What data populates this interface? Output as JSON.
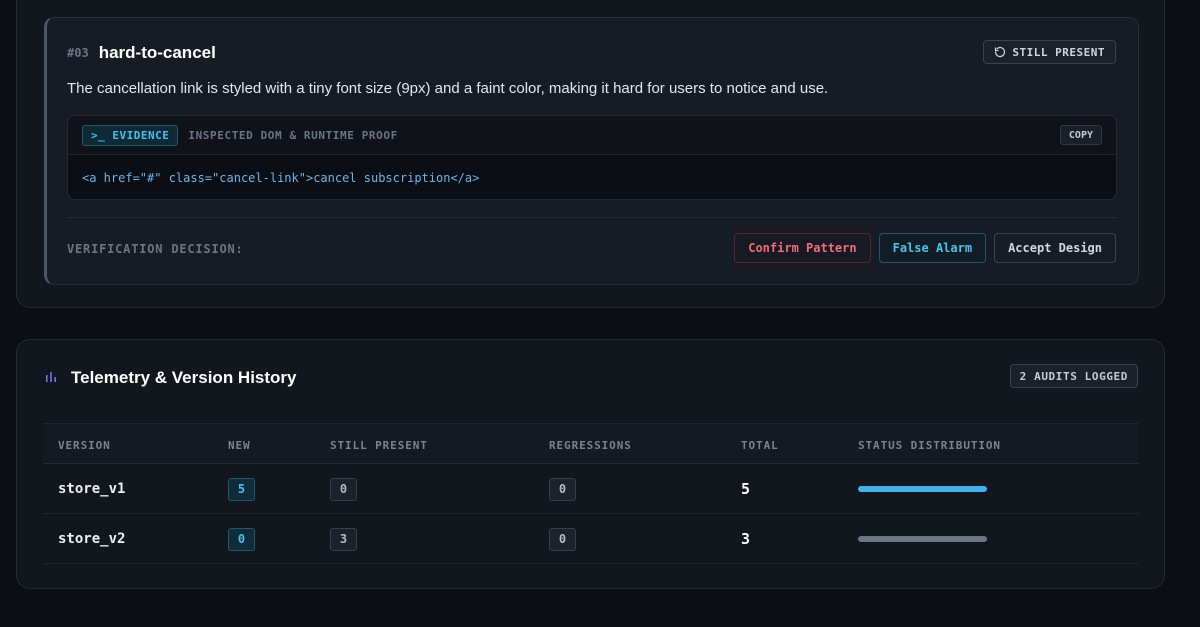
{
  "finding": {
    "number": "#03",
    "title": "hard-to-cancel",
    "status": "STILL PRESENT",
    "status_icon": "rotate-ccw-icon",
    "description": "The cancellation link is styled with a tiny font size (9px) and a faint color, making it hard for users to notice and use.",
    "evidence": {
      "badge": ">_ EVIDENCE",
      "subtitle": "INSPECTED DOM & RUNTIME PROOF",
      "copy_label": "COPY",
      "code": "<a href=\"#\" class=\"cancel-link\">cancel subscription</a>"
    },
    "verification": {
      "label": "VERIFICATION DECISION:",
      "confirm": "Confirm Pattern",
      "false_alarm": "False Alarm",
      "accept": "Accept Design"
    }
  },
  "telemetry": {
    "title": "Telemetry & Version History",
    "icon": "bar-chart-icon",
    "audits_logged": "2 AUDITS LOGGED",
    "columns": [
      "VERSION",
      "NEW",
      "STILL PRESENT",
      "REGRESSIONS",
      "TOTAL",
      "STATUS DISTRIBUTION"
    ],
    "rows": [
      {
        "version": "store_v1",
        "new": "5",
        "still_present": "0",
        "regressions": "0",
        "total": "5",
        "distribution_color": "#3fb3ef"
      },
      {
        "version": "store_v2",
        "new": "0",
        "still_present": "3",
        "regressions": "0",
        "total": "3",
        "distribution_color": "#6b7585"
      }
    ]
  },
  "colors": {
    "accent_blue": "#43c3ef",
    "danger": "#f36b7d",
    "background": "#0b0e13"
  }
}
